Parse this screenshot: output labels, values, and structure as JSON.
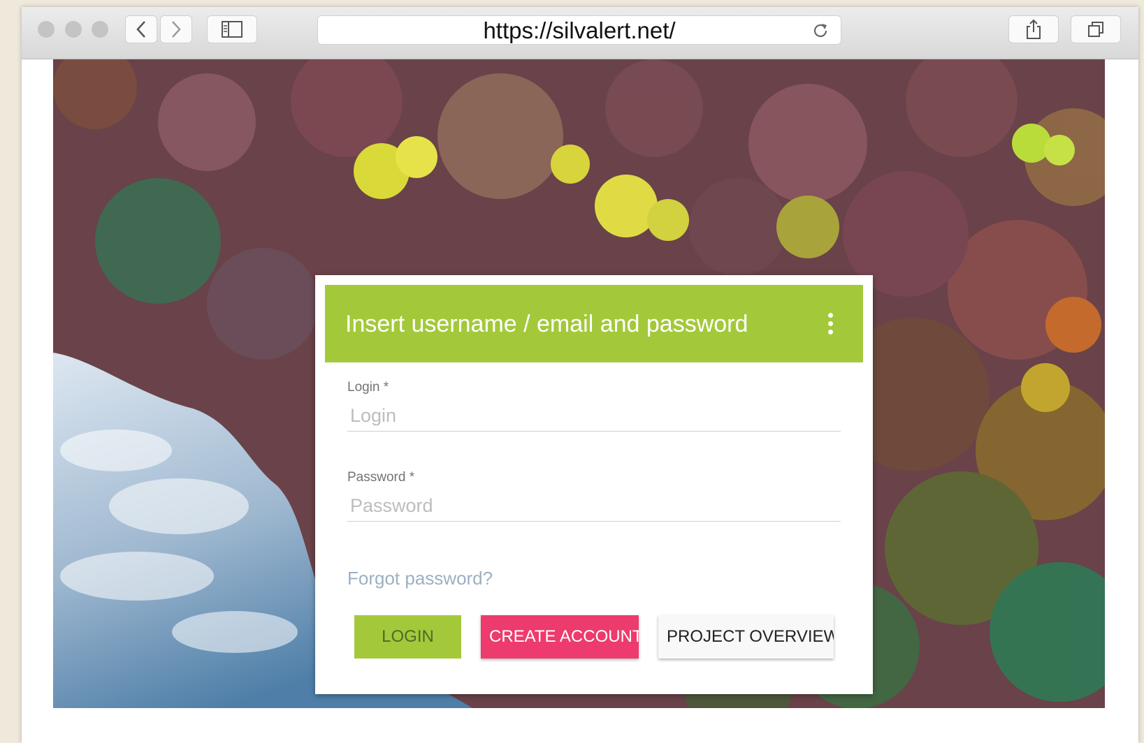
{
  "browser": {
    "url": "https://silvalert.net/",
    "traffic_light_color": "#c4c4c4"
  },
  "login_card": {
    "title": "Insert username / email and password",
    "header_color": "#a3c93a",
    "login_label": "Login *",
    "login_placeholder": "Login",
    "password_label": "Password *",
    "password_placeholder": "Password",
    "forgot_link": "Forgot password?",
    "buttons": {
      "login": "LOGIN",
      "create_account": "CREATE ACCOUNT",
      "project_overview": "PROJECT OVERVIEW"
    },
    "accent_pink": "#ec3b6c"
  },
  "icons": [
    "back-icon",
    "forward-icon",
    "sidebar-icon",
    "reload-icon",
    "share-icon",
    "tabs-icon",
    "kebab-menu-icon"
  ]
}
